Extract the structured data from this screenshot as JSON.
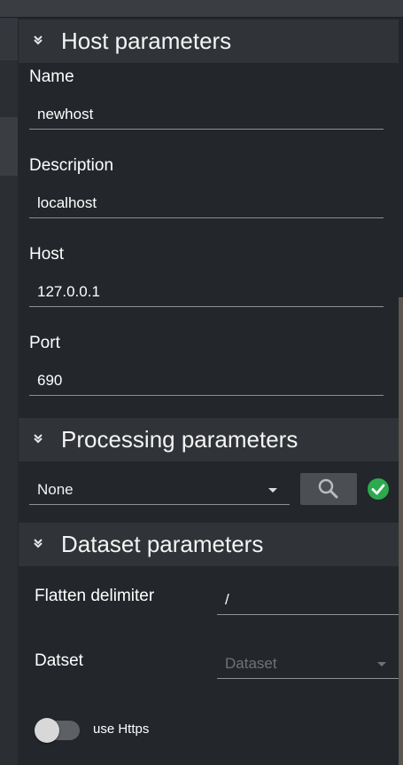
{
  "host_section": {
    "title": "Host parameters",
    "fields": [
      {
        "label": "Name",
        "value": "newhost"
      },
      {
        "label": "Description",
        "value": "localhost"
      },
      {
        "label": "Host",
        "value": "127.0.0.1"
      },
      {
        "label": "Port",
        "value": "690"
      }
    ]
  },
  "processing_section": {
    "title": "Processing parameters",
    "selected": "None",
    "search_icon": "search-icon",
    "status_icon": "check-circle-icon",
    "status_color": "#2eaa4e"
  },
  "dataset_section": {
    "title": "Dataset parameters",
    "flatten_label": "Flatten delimiter",
    "flatten_value": "/",
    "dataset_label": "Datset",
    "dataset_placeholder": "Dataset",
    "https_label": "use Https",
    "https_enabled": false
  },
  "colors": {
    "background": "#23262b",
    "header": "#303337",
    "accent_green": "#2eaa4e"
  }
}
